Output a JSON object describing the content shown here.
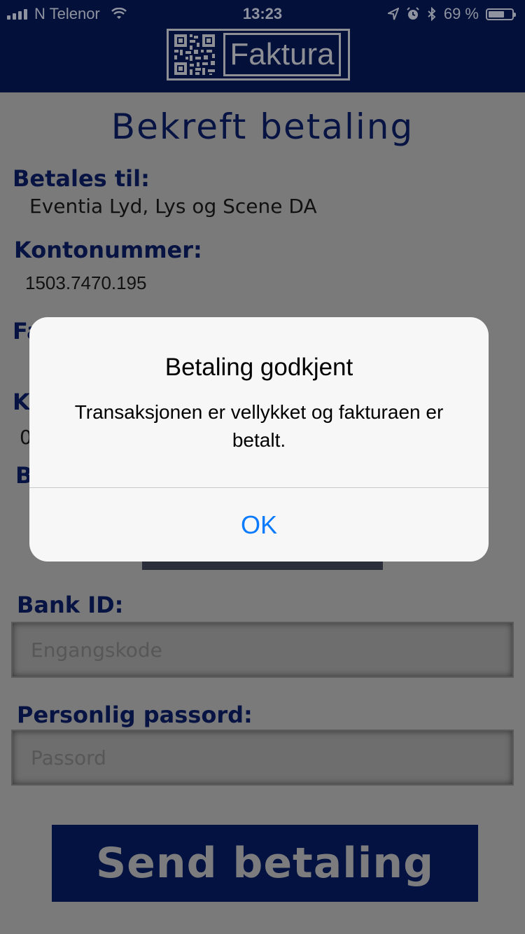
{
  "status_bar": {
    "carrier": "N Telenor",
    "time": "13:23",
    "battery": "69 %",
    "battery_level": 0.69
  },
  "header": {
    "logo_text": "Faktura",
    "logo_icon": "qr-code-icon"
  },
  "page": {
    "title": "Bekreft betaling",
    "payee_label": "Betales til:",
    "payee_value": "Eventia Lyd, Lys og Scene DA",
    "account_label": "Kontonummer:",
    "account_value": "1503.7470.195",
    "obscured_label_1": "Fa",
    "obscured_label_2": "K",
    "obscured_value_2": "0",
    "obscured_label_3": "B",
    "bankid_label": "Bank ID:",
    "bankid_placeholder": "Engangskode",
    "password_label": "Personlig passord:",
    "password_placeholder": "Passord",
    "send_button": "Send betaling"
  },
  "alert": {
    "title": "Betaling godkjent",
    "message": "Transaksjonen er vellykket og fakturaen er betalt.",
    "ok_button": "OK"
  },
  "colors": {
    "header_bg": "#02103a",
    "accent_link": "#0a7aff",
    "label_text": "#071443"
  }
}
